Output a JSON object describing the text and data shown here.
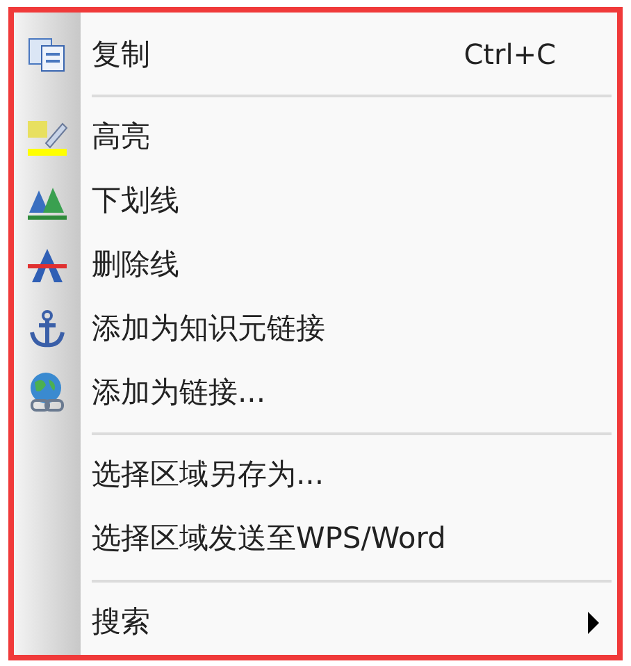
{
  "menu": {
    "items": [
      {
        "kind": "item",
        "label": "复制",
        "shortcut": "Ctrl+C",
        "submenu": false
      },
      {
        "kind": "separator"
      },
      {
        "kind": "item",
        "label": "高亮",
        "submenu": false
      },
      {
        "kind": "item",
        "label": "下划线",
        "submenu": false
      },
      {
        "kind": "item",
        "label": "删除线",
        "submenu": false
      },
      {
        "kind": "item",
        "label": "添加为知识元链接",
        "submenu": false
      },
      {
        "kind": "item",
        "label": "添加为链接...",
        "submenu": false
      },
      {
        "kind": "separator"
      },
      {
        "kind": "item",
        "label": "选择区域另存为...",
        "submenu": false
      },
      {
        "kind": "item",
        "label": "选择区域发送至WPS/Word",
        "submenu": false
      },
      {
        "kind": "separator"
      },
      {
        "kind": "item",
        "label": "搜索",
        "submenu": true
      }
    ]
  }
}
